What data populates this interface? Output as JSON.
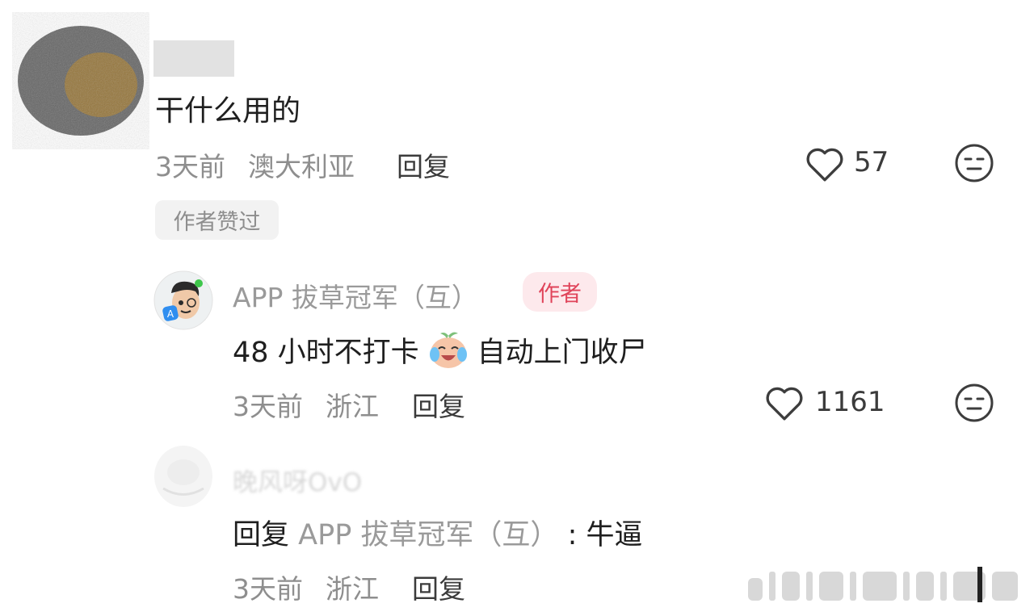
{
  "comments": [
    {
      "text": "干什么用的",
      "time": "3天前",
      "location": "澳大利亚",
      "reply_label": "回复",
      "likes": "57",
      "badge": "作者赞过",
      "replies": [
        {
          "username": "APP 拔草冠军（互）",
          "author_tag": "作者",
          "text_before": "48 小时不打卡",
          "text_after": "自动上门收尸",
          "time": "3天前",
          "location": "浙江",
          "reply_label": "回复",
          "likes": "1161"
        },
        {
          "username": "晚风呀OvO",
          "reply_prefix": "回复",
          "reply_target": "APP 拔草冠军（互）",
          "reply_colon": ": 牛逼",
          "time": "3天前",
          "location": "浙江",
          "reply_label": "回复"
        }
      ]
    }
  ],
  "icons": {
    "like": "heart-outline-icon",
    "dislike": "neutral-face-icon",
    "emoji": "crying-laughing-face-icon"
  },
  "colors": {
    "author_tag_bg": "#fde9ec",
    "author_tag_text": "#e0445a",
    "meta": "#8e8e8e"
  }
}
